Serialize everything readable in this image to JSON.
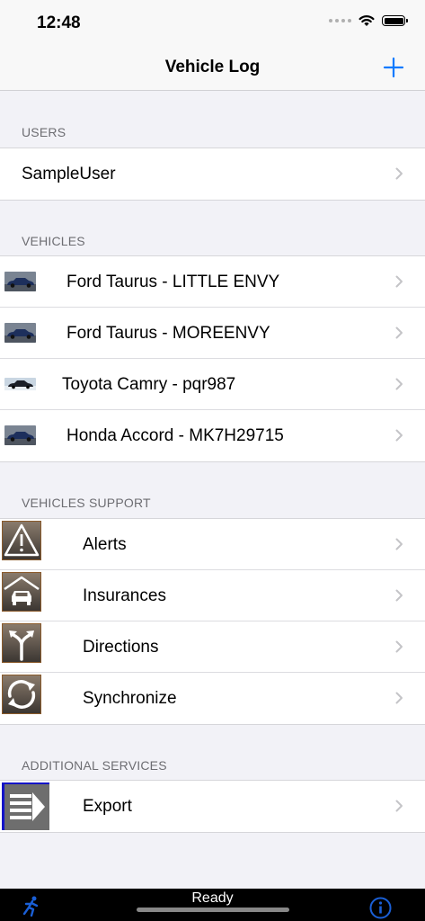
{
  "status_bar": {
    "time": "12:48"
  },
  "nav": {
    "title": "Vehicle Log",
    "add_icon": "plus-icon"
  },
  "sections": {
    "users": {
      "header": "USERS",
      "items": [
        {
          "label": "SampleUser"
        }
      ]
    },
    "vehicles": {
      "header": "VEHICLES",
      "items": [
        {
          "label": "Ford Taurus - LITTLE ENVY",
          "icon": "car-thumbnail"
        },
        {
          "label": "Ford Taurus - MOREENVY",
          "icon": "car-thumbnail"
        },
        {
          "label": "Toyota Camry - pqr987",
          "icon": "car-thumbnail"
        },
        {
          "label": "Honda Accord - MK7H29715",
          "icon": "car-thumbnail"
        }
      ]
    },
    "support": {
      "header": "VEHICLES SUPPORT",
      "items": [
        {
          "label": "Alerts",
          "icon": "warning-icon"
        },
        {
          "label": "Insurances",
          "icon": "garage-car-icon"
        },
        {
          "label": "Directions",
          "icon": "directions-icon"
        },
        {
          "label": "Synchronize",
          "icon": "sync-icon"
        }
      ]
    },
    "additional": {
      "header": "ADDITIONAL SERVICES",
      "items": [
        {
          "label": "Export",
          "icon": "export-icon"
        }
      ]
    }
  },
  "bottom_bar": {
    "status": "Ready",
    "left_icon": "runner-icon",
    "right_icon": "info-icon"
  },
  "colors": {
    "accent": "#0a7aff",
    "background": "#f2f2f7",
    "header_text": "#6d6d72"
  }
}
